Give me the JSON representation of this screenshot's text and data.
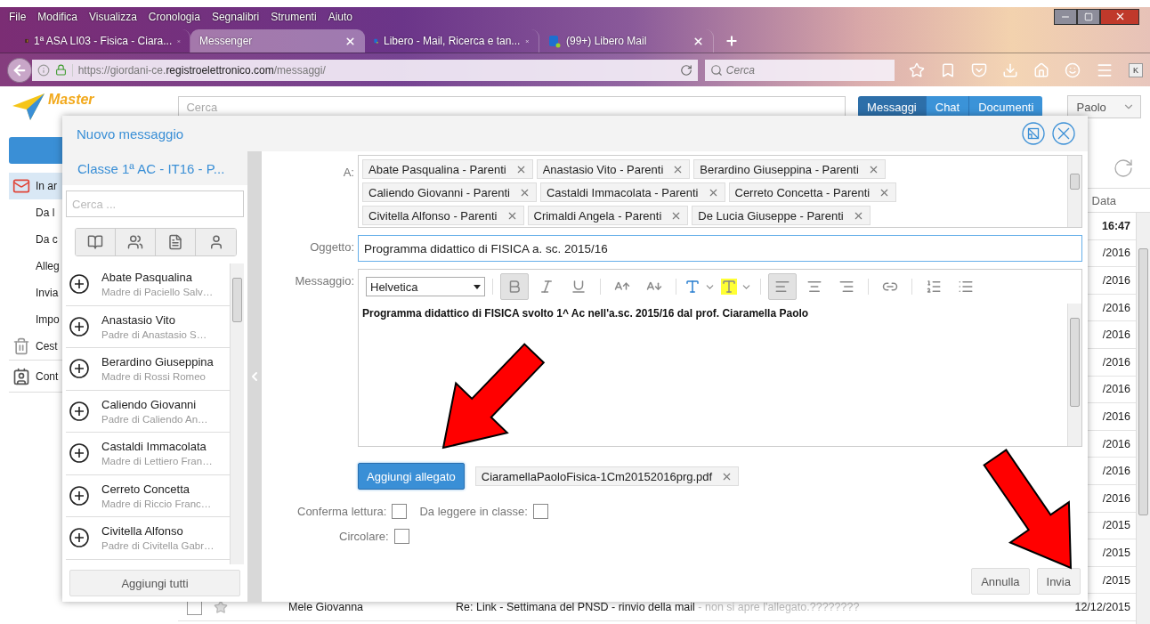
{
  "browser": {
    "menu": [
      "File",
      "Modifica",
      "Visualizza",
      "Cronologia",
      "Segnalibri",
      "Strumenti",
      "Aiuto"
    ],
    "tabs": [
      {
        "title": "1ª ASA LI03 - Fisica - Ciara...",
        "selected": false
      },
      {
        "title": "Messenger",
        "selected": true
      },
      {
        "title": "Libero - Mail, Ricerca e tan...",
        "selected": false
      },
      {
        "title": "(99+) Libero Mail",
        "selected": false
      }
    ],
    "url": "https://giordani-ce.**registroelettronico.com**/messaggi/",
    "search_placeholder": "Cerca",
    "profile_badge": "K"
  },
  "app": {
    "logo": "Master",
    "search_placeholder": "Cerca",
    "sections": [
      {
        "label": "Messaggi",
        "selected": true
      },
      {
        "label": "Chat",
        "selected": false
      },
      {
        "label": "Documenti",
        "selected": false
      }
    ],
    "user": "Paolo",
    "folders": [
      {
        "label": "In ar",
        "selected": true
      },
      {
        "label": "Da l",
        "selected": false
      },
      {
        "label": "Da c",
        "selected": false
      },
      {
        "label": "Alleg",
        "selected": false
      },
      {
        "label": "Invia",
        "selected": false
      },
      {
        "label": "Impo",
        "selected": false
      },
      {
        "label": "Cest",
        "selected": false
      },
      {
        "label": "Cont",
        "selected": false
      }
    ],
    "column_header": "Data",
    "messages": [
      {
        "date": "16:47",
        "unread": true
      },
      {
        "date": "/2016",
        "unread": false
      },
      {
        "date": "/2016",
        "unread": false
      },
      {
        "date": "/2016",
        "unread": false
      },
      {
        "date": "/2016",
        "unread": false
      },
      {
        "date": "/2016",
        "unread": false
      },
      {
        "date": "/2016",
        "unread": false
      },
      {
        "date": "/2016",
        "unread": false
      },
      {
        "date": "/2016",
        "unread": false
      },
      {
        "date": "/2016",
        "unread": false
      },
      {
        "date": "/2016",
        "unread": false
      },
      {
        "date": "/2015",
        "unread": false
      },
      {
        "date": "/2015",
        "unread": false
      },
      {
        "date": "/2015",
        "unread": false
      },
      {
        "sender": "Mele Giovanna",
        "subject": "Re: Link - Settimana del PNSD - rinvio della mail",
        "preview": "- non si apre l'allegato.????????",
        "date": "12/12/2015",
        "unread": false,
        "checked": false,
        "starred": false
      }
    ]
  },
  "dialog": {
    "title": "Nuovo messaggio",
    "class_title": "Classe 1ª AC - IT16 - P...",
    "search_placeholder": "Cerca ...",
    "contacts": [
      {
        "name": "Abate Pasqualina",
        "relation": "Madre di Paciello Salv…"
      },
      {
        "name": "Anastasio Vito",
        "relation": "Padre di Anastasio S…"
      },
      {
        "name": "Berardino Giuseppina",
        "relation": "Madre di Rossi Romeo"
      },
      {
        "name": "Caliendo Giovanni",
        "relation": "Padre di Caliendo An…"
      },
      {
        "name": "Castaldi Immacolata",
        "relation": "Madre di Lettiero Fran…"
      },
      {
        "name": "Cerreto Concetta",
        "relation": "Madre di Riccio Franc…"
      },
      {
        "name": "Civitella Alfonso",
        "relation": "Padre di Civitella Gabr…"
      }
    ],
    "add_all": "Aggiungi tutti",
    "to_label": "A:",
    "recipients": [
      "Abate Pasqualina - Parenti",
      "Anastasio Vito - Parenti",
      "Berardino Giuseppina - Parenti",
      "Caliendo Giovanni - Parenti",
      "Castaldi Immacolata - Parenti",
      "Cerreto Concetta - Parenti",
      "Civitella Alfonso - Parenti",
      "Crimaldi Angela - Parenti",
      "De Lucia Giuseppe - Parenti"
    ],
    "subject_label": "Oggetto:",
    "subject": "Programma didattico di FISICA a. sc. 2015/16",
    "message_label": "Messaggio:",
    "font": "Helvetica",
    "tool_groups": [
      [
        {
          "kind": "bold",
          "active": true
        },
        {
          "kind": "italic",
          "active": false
        },
        {
          "kind": "underline",
          "active": false
        }
      ],
      [
        {
          "kind": "grow",
          "active": false
        },
        {
          "kind": "shrink",
          "active": false
        }
      ],
      [
        {
          "kind": "text-color",
          "active": false
        },
        {
          "kind": "highlight",
          "active": false
        }
      ],
      [
        {
          "kind": "align-left",
          "active": true
        },
        {
          "kind": "align-center",
          "active": false
        },
        {
          "kind": "align-right",
          "active": false
        }
      ],
      [
        {
          "kind": "link",
          "active": false
        }
      ],
      [
        {
          "kind": "ordered-list",
          "active": false
        },
        {
          "kind": "bullet-list",
          "active": false
        }
      ]
    ],
    "body": "Programma didattico di FISICA svolto 1^ Ac nell'a.sc. 2015/16 dal prof. Ciaramella Paolo",
    "attach_button": "Aggiungi allegato",
    "attachments": [
      "CiaramellaPaoloFisica-1Cm20152016prg.pdf"
    ],
    "options": [
      [
        {
          "label": "Conferma lettura:",
          "checked": false
        },
        {
          "label": "Da leggere in classe:",
          "checked": false
        }
      ],
      [
        {
          "label": "Circolare:",
          "checked": false
        }
      ]
    ],
    "buttons": [
      "Annulla",
      "Invia"
    ]
  }
}
